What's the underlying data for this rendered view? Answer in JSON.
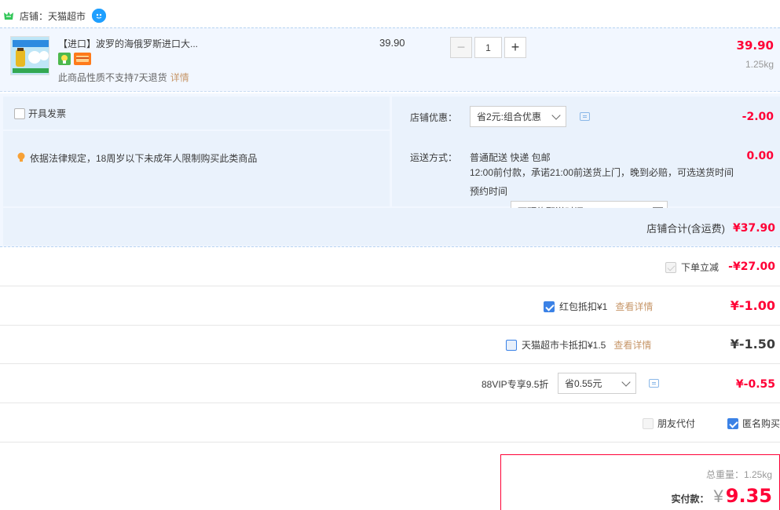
{
  "shop": {
    "label": "店铺：",
    "name": "天猫超市"
  },
  "item": {
    "title": "【进口】波罗的海俄罗斯进口大...",
    "unit_price": "39.90",
    "quantity": "1",
    "minus": "−",
    "plus": "+",
    "total": "39.90",
    "weight": "1.25kg",
    "note": "此商品性质不支持7天退货",
    "note_link": "详情"
  },
  "invoice": {
    "label": "开具发票"
  },
  "legal_notice": "依据法律规定，18周岁以下未成年人限制购买此类商品",
  "shop_discount": {
    "label": "店铺优惠：",
    "selected": "省2元:组合优惠",
    "amount": "-2.00"
  },
  "shipping": {
    "label": "运送方式：",
    "method": "普通配送 快递 包邮",
    "promise": "12:00前付款，承诺21:00前送货上门，晚到必赔，可选送货时间",
    "time_label": "预约时间",
    "time_placeholder": "可预约配送时间",
    "amount": "0.00"
  },
  "shop_total": {
    "label": "店铺合计(含运费)",
    "amount": "¥37.90"
  },
  "discounts": {
    "instant": {
      "label": "下单立减",
      "amount": "-¥27.00"
    },
    "red_packet": {
      "label": "红包抵扣¥1",
      "link": "查看详情",
      "amount": "¥-1.00"
    },
    "tmall_card": {
      "label": "天猫超市卡抵扣¥1.5",
      "link": "查看详情",
      "amount": "¥-1.50"
    },
    "vip": {
      "label": "88VIP专享9.5折",
      "selected": "省0.55元",
      "amount": "¥-0.55"
    }
  },
  "options": {
    "friend_pay": "朋友代付",
    "anonymous": "匿名购买"
  },
  "summary": {
    "weight_label": "总重量：",
    "weight": "1.25kg",
    "pay_label": "实付款：",
    "currency": "¥",
    "pay_amount": "9.35"
  },
  "colors": {
    "accent": "#ff0036",
    "panel": "#eaf2fc",
    "link": "#c7976a",
    "check": "#3b82e6"
  }
}
